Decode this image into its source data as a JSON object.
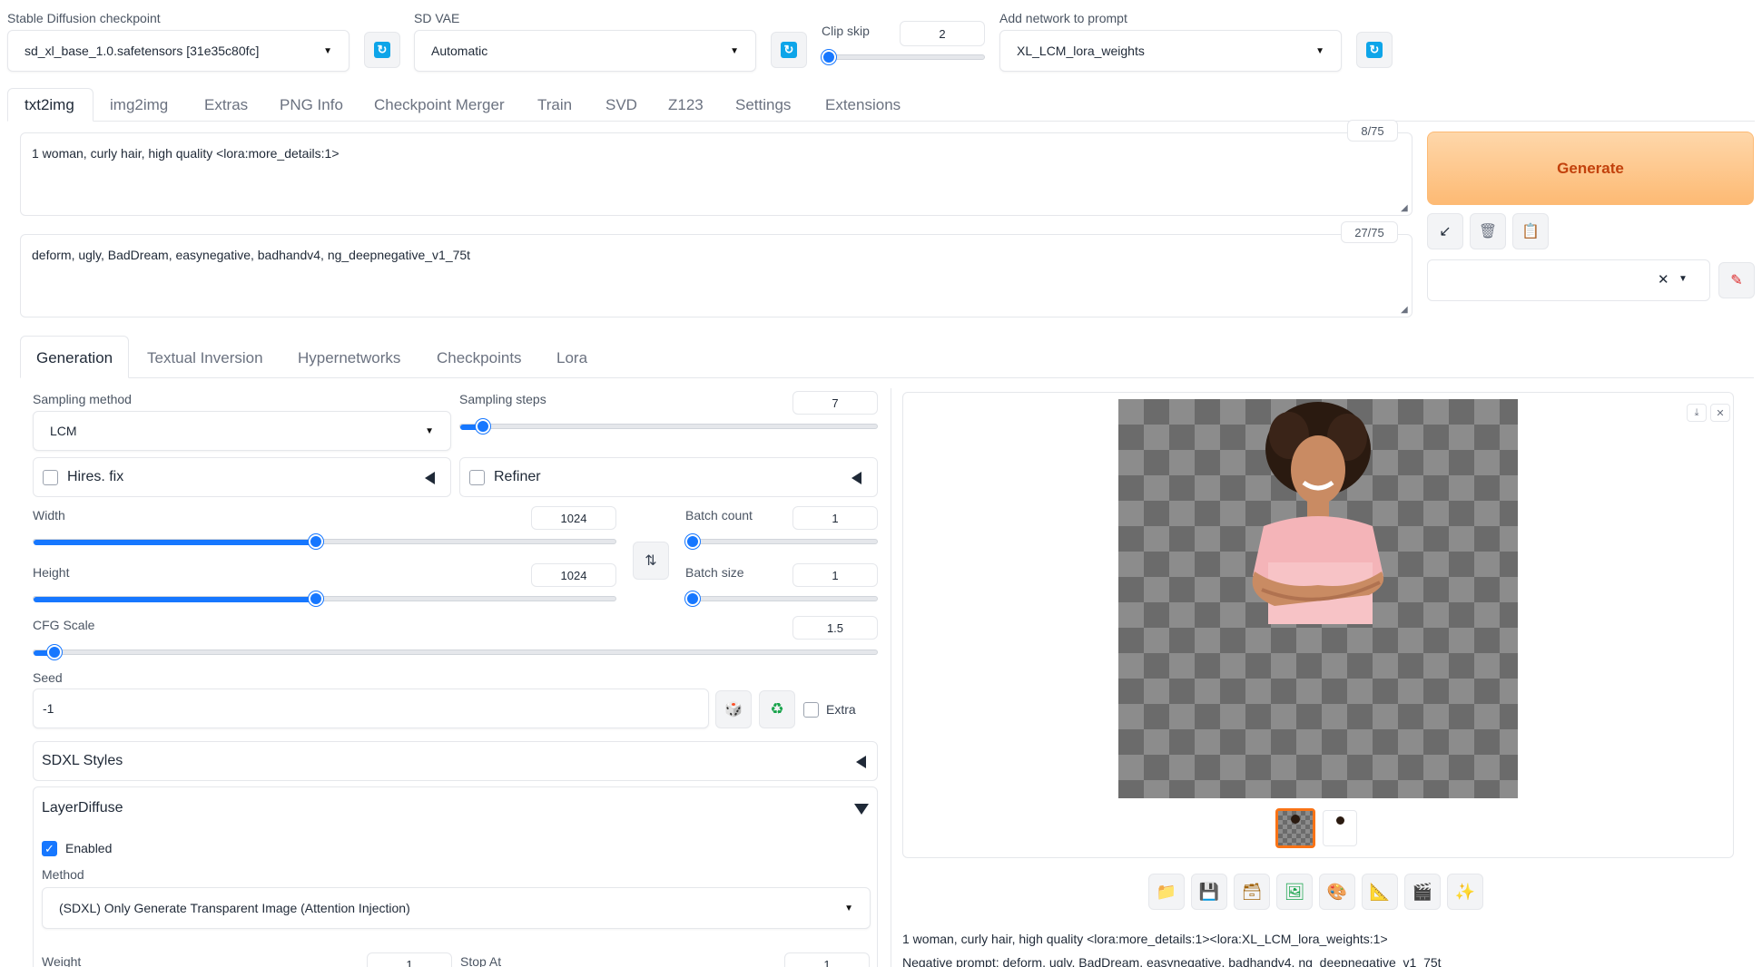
{
  "top": {
    "checkpoint": {
      "label": "Stable Diffusion checkpoint",
      "value": "sd_xl_base_1.0.safetensors [31e35c80fc]"
    },
    "vae": {
      "label": "SD VAE",
      "value": "Automatic"
    },
    "clip_skip": {
      "label": "Clip skip",
      "value": "2",
      "level": 0.05
    },
    "network": {
      "label": "Add network to prompt",
      "value": "XL_LCM_lora_weights"
    }
  },
  "main_tabs": [
    "txt2img",
    "img2img",
    "Extras",
    "PNG Info",
    "Checkpoint Merger",
    "Train",
    "SVD",
    "Z123",
    "Settings",
    "Extensions"
  ],
  "prompt": {
    "text": "1 woman, curly hair, high quality  <lora:more_details:1>",
    "counter": "8/75"
  },
  "negative_prompt": {
    "text": "deform, ugly,  BadDream, easynegative, badhandv4, ng_deepnegative_v1_75t",
    "counter": "27/75"
  },
  "generate_label": "Generate",
  "sub_tabs": [
    "Generation",
    "Textual Inversion",
    "Hypernetworks",
    "Checkpoints",
    "Lora"
  ],
  "generation": {
    "sampling_method": {
      "label": "Sampling method",
      "value": "LCM"
    },
    "sampling_steps": {
      "label": "Sampling steps",
      "value": "7",
      "level": 0.04
    },
    "hires_fix": "Hires. fix",
    "refiner": "Refiner",
    "width": {
      "label": "Width",
      "value": "1024",
      "level": 0.48
    },
    "height": {
      "label": "Height",
      "value": "1024",
      "level": 0.48
    },
    "batch_count": {
      "label": "Batch count",
      "value": "1",
      "level": 0
    },
    "batch_size": {
      "label": "Batch size",
      "value": "1",
      "level": 0
    },
    "cfg_scale": {
      "label": "CFG Scale",
      "value": "1.5",
      "level": 0.02
    },
    "seed": {
      "label": "Seed",
      "value": "-1"
    },
    "extra": "Extra",
    "sdxl_styles": "SDXL Styles",
    "layerdiffuse": {
      "title": "LayerDiffuse",
      "enabled": "Enabled",
      "method_label": "Method",
      "method_value": "(SDXL) Only Generate Transparent Image (Attention Injection)",
      "weight_label": "Weight",
      "weight_value": "1",
      "stop_at_label": "Stop At",
      "stop_at_value": "1"
    }
  },
  "output": {
    "info_prompt": "1 woman, curly hair, high quality <lora:more_details:1><lora:XL_LCM_lora_weights:1>",
    "info_negative": "Negative prompt: deform, ugly, BadDream, easynegative, badhandv4, ng_deepnegative_v1_75t"
  },
  "icons": {
    "tool_buttons": [
      "folder-icon",
      "save-icon",
      "zip-icon",
      "send-to-img2img-icon",
      "send-to-inpaint-icon",
      "send-to-extras-icon",
      "video-icon",
      "sparkle-icon"
    ]
  },
  "colors": {
    "accent": "#1677ff",
    "generate_bg": "#fdba74",
    "generate_text": "#c2410c",
    "refresh": "#0ea5e9"
  }
}
